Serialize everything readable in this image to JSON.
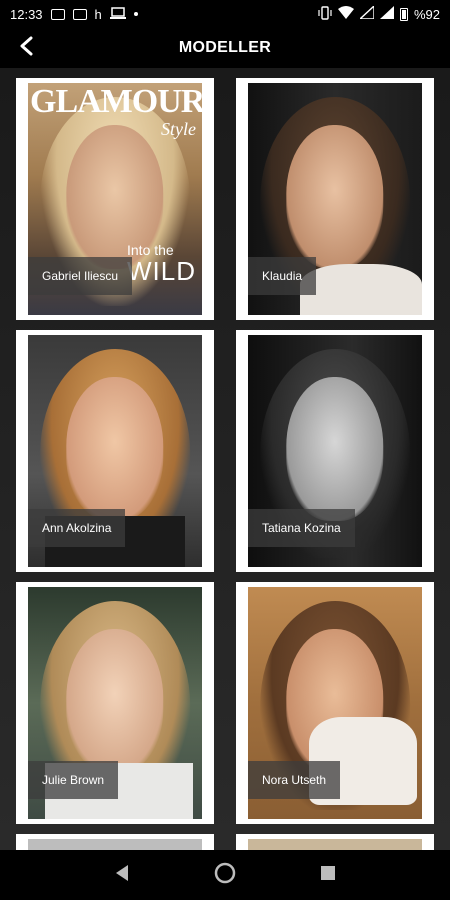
{
  "status_bar": {
    "time": "12:33",
    "carrier_letter": "h",
    "battery_percent": "%92"
  },
  "app_bar": {
    "title": "MODELLER"
  },
  "magazine_cover": {
    "title": "GLAMOUR",
    "subtitle": "Style",
    "headline_small": "Into the",
    "headline_big": "WILD"
  },
  "models": [
    {
      "name": "Gabriel Iliescu"
    },
    {
      "name": "Klaudia"
    },
    {
      "name": "Ann Akolzina"
    },
    {
      "name": "Tatiana Kozina"
    },
    {
      "name": "Julie Brown"
    },
    {
      "name": "Nora Utseth"
    }
  ],
  "colors": {
    "background": "#000000",
    "card": "#ffffff",
    "name_tag": "#3c3c3c"
  }
}
